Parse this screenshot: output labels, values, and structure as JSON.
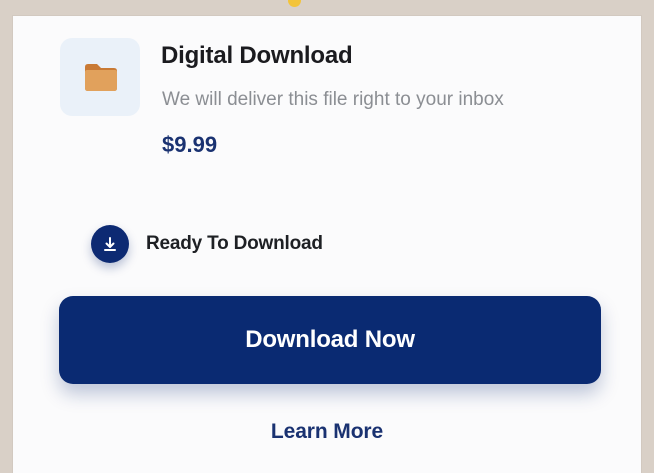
{
  "product": {
    "title": "Digital Download",
    "description": "We will deliver this file right to your inbox",
    "price": "$9.99",
    "icon": "folder-icon"
  },
  "status": {
    "label": "Ready To Download",
    "icon": "download-icon"
  },
  "actions": {
    "primary_label": "Download Now",
    "secondary_label": "Learn More"
  },
  "colors": {
    "accent": "#0a2a72",
    "price": "#1a3271",
    "thumbnail": "#eaf1f9",
    "folder": "#d7914b",
    "indicator": "#f3c43a"
  }
}
